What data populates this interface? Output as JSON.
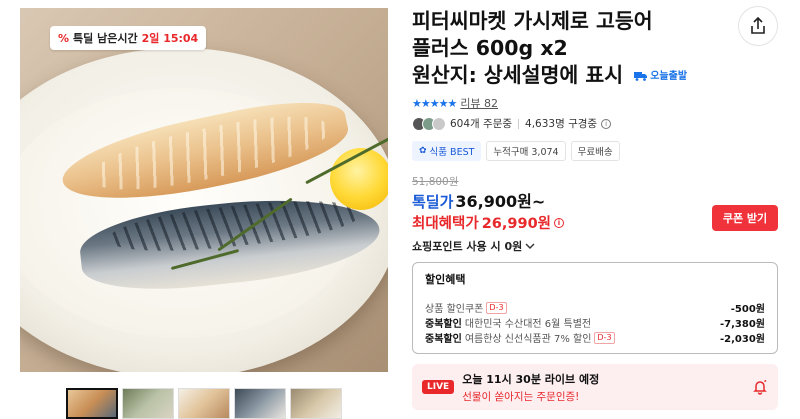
{
  "timer": {
    "label": "특딜 남은시간",
    "time": "2일 15:04"
  },
  "thumbnails": [
    {
      "name": "thumb-1",
      "active": true
    },
    {
      "name": "thumb-2",
      "active": false
    },
    {
      "name": "thumb-3",
      "active": false
    },
    {
      "name": "thumb-4",
      "active": false
    },
    {
      "name": "thumb-5",
      "active": false
    }
  ],
  "product": {
    "title_line1": "피터씨마켓 가시제로 고등어",
    "title_line2": "플러스 600g x2",
    "title_line3": "원산지: 상세설명에 표시",
    "delivery_tag": "오늘출발"
  },
  "rating": {
    "stars": "★★★★★",
    "review_label": "리뷰 82"
  },
  "buyers": {
    "orders": "604개 주문중",
    "subscribers": "4,633명 구경중"
  },
  "tags": [
    "식품 BEST",
    "누적구매 3,074",
    "무료배송"
  ],
  "price": {
    "original": "51,800원",
    "deal_label": "톡딜가",
    "deal_price": "36,900원~",
    "max_label": "최대혜택가",
    "max_price": "26,990원"
  },
  "coupon_button": "쿠폰 받기",
  "points": "쇼핑포인트 사용 시 0원",
  "discounts": {
    "header": "할인혜택",
    "rows": [
      {
        "bold": "",
        "text": "상품 할인쿠폰",
        "tag": "D-3",
        "amount": "-500원"
      },
      {
        "bold": "중복할인",
        "text": "대한민국 수산대전 6월 특별전",
        "tag": "",
        "amount": "-7,380원"
      },
      {
        "bold": "중복할인",
        "text": "여름한상 신선식품관 7% 할인",
        "tag": "D-3",
        "amount": "-2,030원"
      }
    ]
  },
  "live": {
    "badge": "LIVE",
    "line1": "오늘 11시 30분 라이브 예정",
    "line2": "선물이 쏟아지는 주문인증!"
  },
  "colors": {
    "accent_red": "#e8282b",
    "accent_blue": "#1a5ad6",
    "coupon_bg": "#f0323b",
    "live_bg": "#fdeef0"
  }
}
